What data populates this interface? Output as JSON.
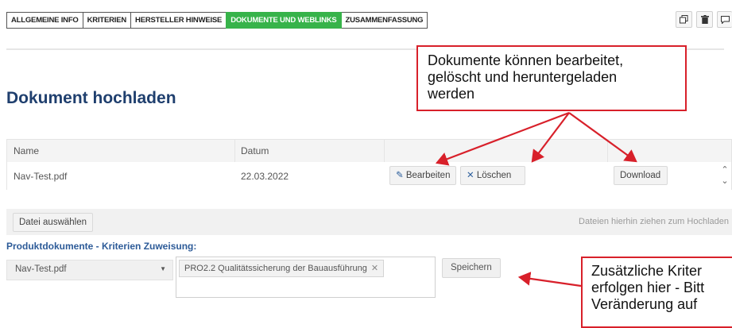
{
  "tabs": [
    {
      "label": "ALLGEMEINE INFO",
      "active": false
    },
    {
      "label": "KRITERIEN",
      "active": false
    },
    {
      "label": "HERSTELLER HINWEISE",
      "active": false
    },
    {
      "label": "DOKUMENTE UND WEBLINKS",
      "active": true
    },
    {
      "label": "ZUSAMMENFASSUNG",
      "active": false
    }
  ],
  "toolbar_icons": [
    "copy-icon",
    "trash-icon",
    "comment-icon"
  ],
  "page_title": "Dokument hochladen",
  "table": {
    "columns": [
      "Name",
      "Datum"
    ],
    "rows": [
      {
        "name": "Nav-Test.pdf",
        "date": "22.03.2022",
        "edit": "Bearbeiten",
        "delete": "Löschen",
        "download": "Download"
      }
    ]
  },
  "upload": {
    "choose_button": "Datei auswählen",
    "drop_hint": "Dateien hierhin ziehen zum Hochladen"
  },
  "assignment": {
    "heading": "Produktdokumente - Kriterien Zuweisung:",
    "selected_document": "Nav-Test.pdf",
    "chips": [
      "PRO2.2 Qualitätssicherung der Bauausführung"
    ],
    "save_button": "Speichern"
  },
  "annotations": {
    "callout_top": [
      "Dokumente können bearbeitet,",
      "gelöscht und heruntergeladen",
      "werden"
    ],
    "callout_bottom": [
      "Zusätzliche Kriter",
      "erfolgen hier - Bitt",
      "Veränderung auf"
    ]
  },
  "colors": {
    "active_tab": "#37b34a",
    "heading": "#1f3f6e",
    "link_blue": "#2d5b98",
    "annotation_red": "#d8202a"
  }
}
